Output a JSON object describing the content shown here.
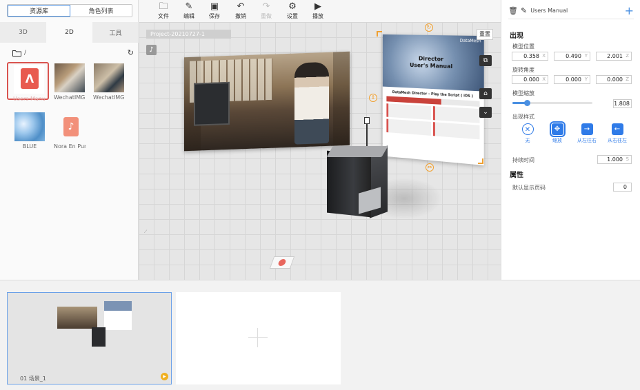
{
  "left": {
    "segments": [
      "资源库",
      "角色列表"
    ],
    "tabs": [
      "3D",
      "2D",
      "工具"
    ],
    "path": "/",
    "assets": [
      {
        "label": "Users Manual",
        "icon": "pdf-icon"
      },
      {
        "label": "WechatIMG16",
        "icon": "image-thumbnail"
      },
      {
        "label": "WechatIMG15",
        "icon": "image-thumbnail"
      },
      {
        "label": "BLUE",
        "icon": "image-thumbnail"
      },
      {
        "label": "Nora En Pur…",
        "icon": "music-icon"
      }
    ]
  },
  "toolbar": {
    "file": "文件",
    "edit": "编辑",
    "save": "保存",
    "undo": "撤销",
    "redo": "重做",
    "settings": "设置",
    "play": "播放"
  },
  "viewport": {
    "project_name": "Project-20210727-1",
    "reset_label": "重置",
    "doc_brand": "DataMesh",
    "doc_title_line1": "Director",
    "doc_title_line2": "User's Manual",
    "doc_subtitle": "DataMesh Director – Play the Script ( iOS )"
  },
  "right": {
    "object_name": "Users Manual",
    "section_appear": "出现",
    "position_label": "模型位置",
    "position": {
      "x": "0.358",
      "y": "0.490",
      "z": "2.001"
    },
    "rotation_label": "旋转角度",
    "rotation": {
      "x": "0.000",
      "y": "0.000",
      "z": "0.000"
    },
    "scale_label": "模型缩放",
    "scale_value": "1.808",
    "scale_fraction": 0.18,
    "style_label": "出现样式",
    "styles": [
      "无",
      "缩放",
      "从左往右",
      "从右往左"
    ],
    "duration_label": "持续时间",
    "duration_value": "1.000",
    "duration_unit": "S",
    "section_props": "属性",
    "page_label": "默认显示页码",
    "page_value": "0",
    "accent_color": "#2f7be8"
  },
  "timeline": {
    "scene_label": "01  场景_1"
  }
}
